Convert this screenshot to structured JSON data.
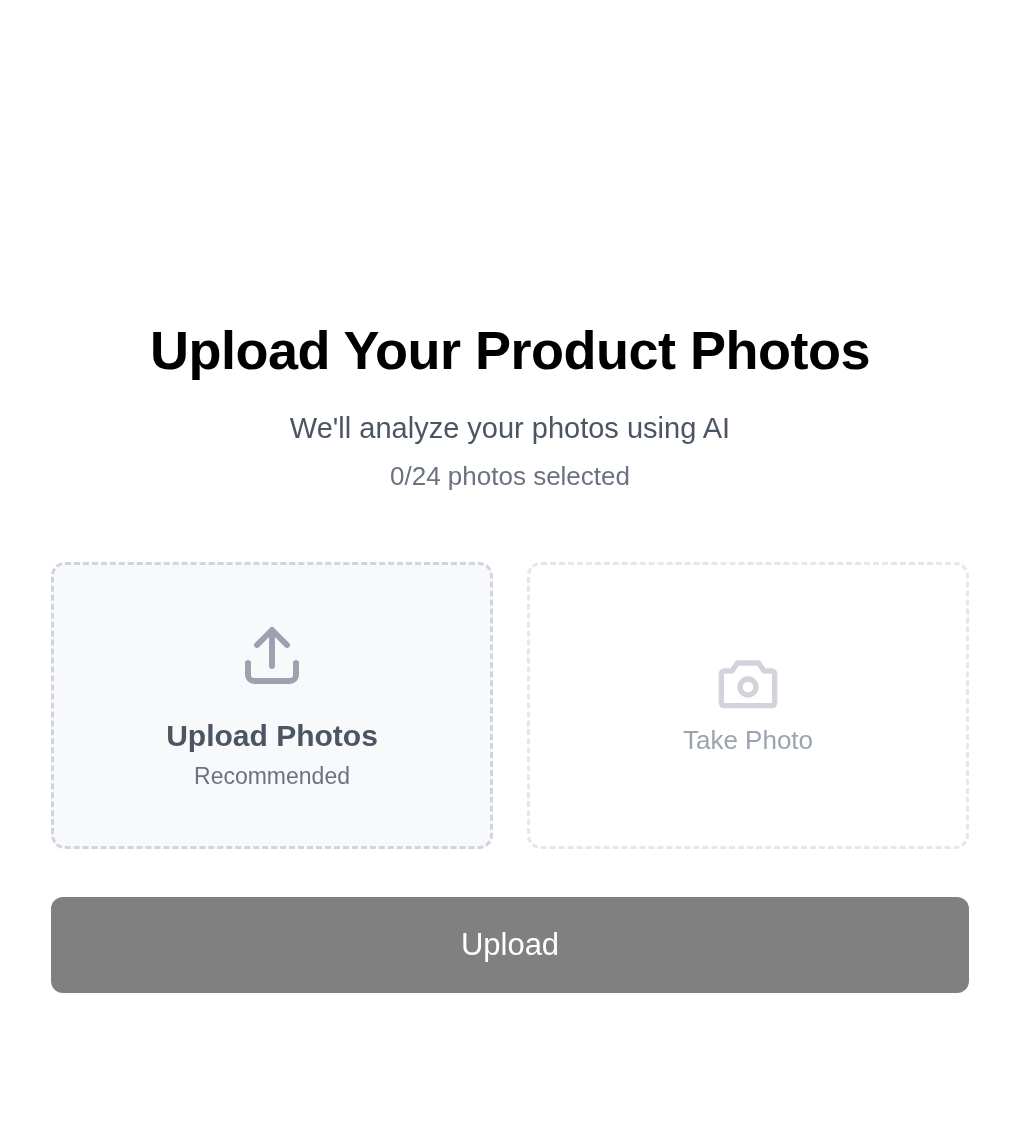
{
  "title": "Upload Your Product Photos",
  "subtitle": "We'll analyze your photos using AI",
  "count": "0/24 photos selected",
  "options": [
    {
      "kind": "upload",
      "label": "Upload Photos",
      "note": "Recommended",
      "disabled": false
    },
    {
      "kind": "camera",
      "label": "Take Photo",
      "disabled": true
    }
  ],
  "button": {
    "label": "Upload",
    "disabled": true
  }
}
